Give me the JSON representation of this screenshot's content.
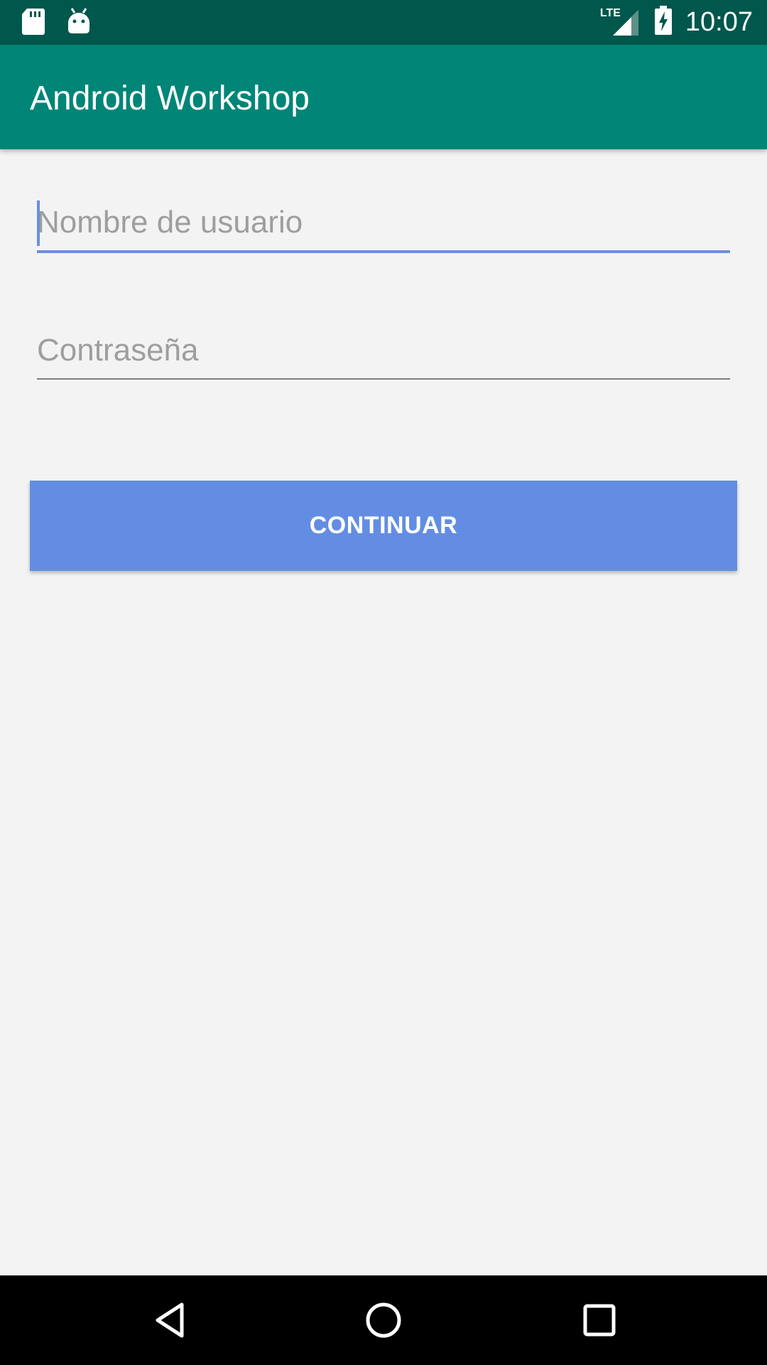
{
  "status_bar": {
    "time": "10:07",
    "network": "LTE",
    "icons": [
      "sd-card-icon",
      "android-icon",
      "signal-icon",
      "battery-charging-icon"
    ]
  },
  "app_bar": {
    "title": "Android Workshop"
  },
  "form": {
    "username_placeholder": "Nombre de usuario",
    "password_placeholder": "Contraseña",
    "continue_label": "CONTINUAR"
  },
  "colors": {
    "status_bar": "#00574b",
    "app_bar": "#008577",
    "accent": "#6b8fdc",
    "button": "#638de2",
    "background": "#f3f3f3"
  },
  "nav_bar": {
    "icons": [
      "back-icon",
      "home-icon",
      "recents-icon"
    ]
  }
}
